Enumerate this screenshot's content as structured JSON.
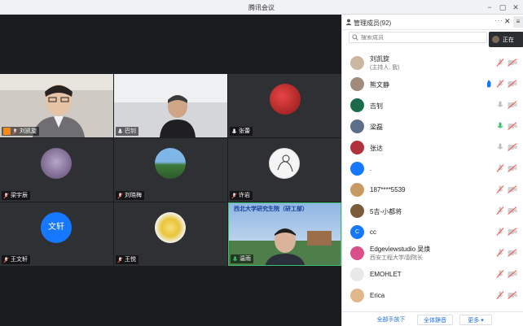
{
  "window": {
    "title": "腾讯会议"
  },
  "stage": {
    "tiles": [
      {
        "name": "刘凯旋",
        "host": true
      },
      {
        "name": "巴钊"
      },
      {
        "name": "张蕾"
      },
      {
        "name": "梁宇辰"
      },
      {
        "name": "刘晓梅"
      },
      {
        "name": "许岩"
      },
      {
        "name": "王文轩",
        "avatar_text": "文轩",
        "avatar_color": "#1677ff"
      },
      {
        "name": "王悦"
      },
      {
        "name": "温雨",
        "banner": "西北大学研究生院（研工部）"
      }
    ]
  },
  "panel": {
    "title": "管理成员(92)",
    "more": "···",
    "close": "✕",
    "extra": "≡",
    "search_placeholder": "搜索成员",
    "tooltip": "正在",
    "members": [
      {
        "name": "刘凯旋",
        "sub": "(主持人, 我)",
        "av": "#c9b7a0",
        "hand": false,
        "mic": "muted",
        "cam": "off"
      },
      {
        "name": "熊文静",
        "av": "#a08a7a",
        "hand": true,
        "mic": "muted",
        "cam": "off"
      },
      {
        "name": "吉钊",
        "av": "#1b6b4a",
        "mic": "on",
        "cam": "off"
      },
      {
        "name": "梁磊",
        "av": "#5b6f8a",
        "mic": "speaking",
        "cam": "off"
      },
      {
        "name": "张达",
        "av": "#b0323a",
        "mic": "on",
        "cam": "off"
      },
      {
        "name": ".",
        "av": "#1677ff",
        "mic": "muted",
        "cam": "off"
      },
      {
        "name": "187****5539",
        "av": "#c89a63",
        "mic": "muted",
        "cam": "off"
      },
      {
        "name": "5吉-小都将",
        "av": "#7b5c3a",
        "mic": "muted",
        "cam": "off"
      },
      {
        "name": "cc",
        "av": "#1677ff",
        "av_letter": "C",
        "mic": "muted",
        "cam": "off"
      },
      {
        "name": "Edgeviewstudio 吴焕",
        "sub": "西安工程大学/副院长",
        "av": "#d94f8a",
        "mic": "muted",
        "cam": "off"
      },
      {
        "name": "EMOHLET",
        "av": "#e8e8e8",
        "mic": "muted",
        "cam": "off"
      },
      {
        "name": "Erica",
        "av": "#e2b78a",
        "mic": "muted",
        "cam": "off"
      }
    ],
    "footer": {
      "mute_all": "全部手放下",
      "mute_all_audio": "全体静音",
      "more": "更多 ▾"
    }
  }
}
